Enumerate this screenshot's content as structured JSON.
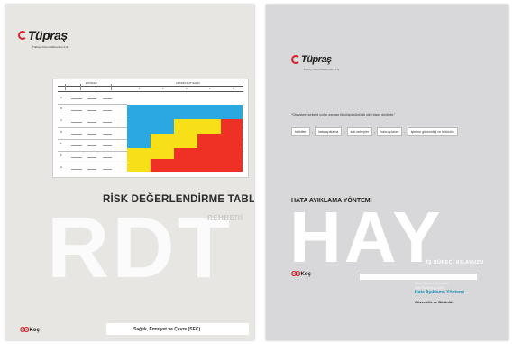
{
  "left_cover": {
    "brand": "Tüpraş",
    "brand_sub": "Türkiye Petrol Rafinerileri A.Ş.",
    "sheet": {
      "group_labels": [
        "ETKİNLER",
        "ARTIRIM SEVİYELERİ"
      ],
      "matrix_columns": [
        "1",
        "2",
        "3",
        "4",
        "5"
      ],
      "row_labels": [
        "A",
        "B",
        "C",
        "D",
        "E",
        "F",
        "G"
      ]
    },
    "title": "RİSK DEĞERLENDİRME TABLOSU",
    "subtitle": "REHBERİ",
    "big_text": "RDT",
    "footer_label": "Sağlık, Emniyet ve Çevre (SEÇ)",
    "footer_brand": "Koç"
  },
  "right_cover": {
    "brand": "Tüpraş",
    "brand_sub": "Türkiye Petrol Rafinerileri A.Ş.",
    "quote": "\"Olayların sebebi çoğu zaman ilk düşünüldüğü gibi basit değildir.\"",
    "flow_steps": [
      "belirtiler",
      "hata ayıklama",
      "kök sebepler",
      "kalıcı çözüm",
      "işletme güvenirliği ve bütünlük"
    ],
    "flow_arrow": "›",
    "title": "HATA AYIKLAMA YÖNTEMİ",
    "big_text": "HAY",
    "subtitle": "İŞ SÜRECİ KILAVUZU",
    "list_faint": [
      "Risk Tabanlı Yönetim",
      "Kök Neden Analizi"
    ],
    "list_accent": "Hata Ayıklama Yöntemi",
    "list_dark": "Güvenirlik ve Bütünlük",
    "footer_brand": "Koç"
  }
}
